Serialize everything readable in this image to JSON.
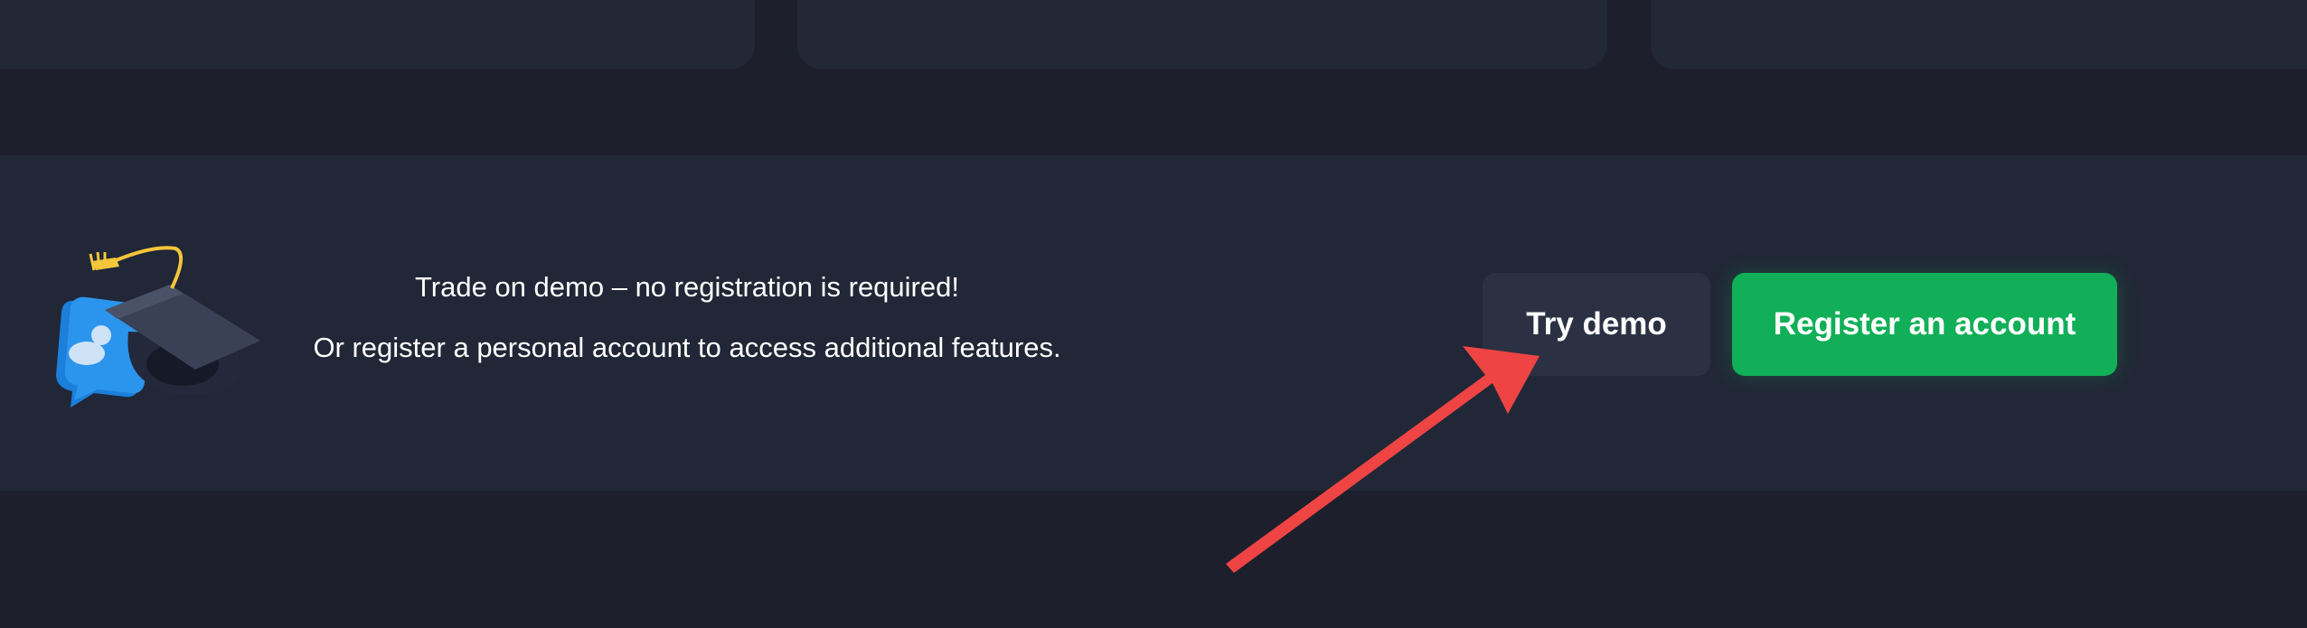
{
  "promo": {
    "line1": "Trade on demo – no registration is required!",
    "line2": "Or register a personal account to access additional features."
  },
  "buttons": {
    "try_demo": "Try demo",
    "register": "Register an account"
  },
  "colors": {
    "page_background": "#1d1f2c",
    "panel_background": "#212736",
    "demo_button": "#2b3142",
    "register_button": "#11af57",
    "annotation_arrow": "#ef4444"
  },
  "icons": {
    "illustration": "graduation-cap-chat-bubble-icon",
    "annotation": "red-arrow-pointer"
  }
}
